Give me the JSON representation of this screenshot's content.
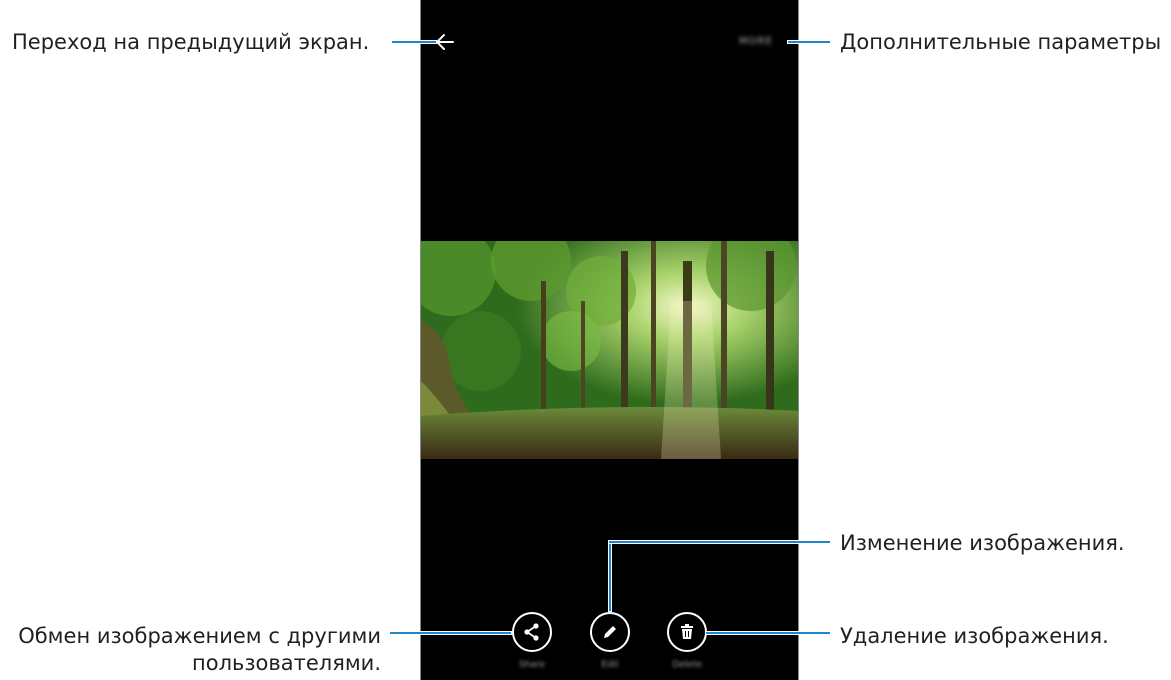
{
  "callouts": {
    "back": "Переход на предыдущий экран.",
    "more": "Дополнительные параметры",
    "edit": "Изменение изображения.",
    "share_line1": "Обмен изображением с другими",
    "share_line2": "пользователями.",
    "delete": "Удаление изображения."
  },
  "screen": {
    "more_label": "MORE",
    "actions": {
      "share": "Share",
      "edit": "Edit",
      "delete": "Delete"
    }
  },
  "colors": {
    "leader_line": "#1d87c9",
    "screen_bg": "#000000",
    "text": "#231f20"
  }
}
